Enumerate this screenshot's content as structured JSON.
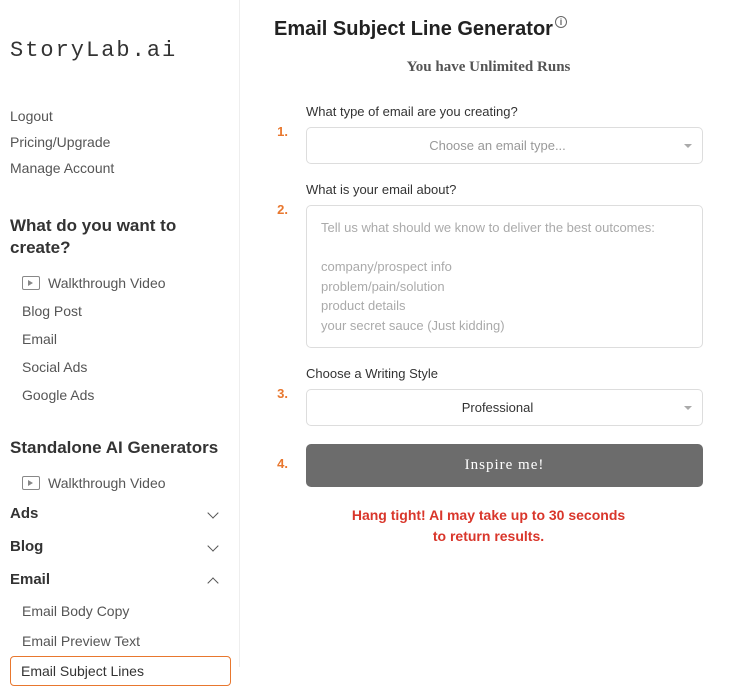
{
  "logo": "StoryLab.ai",
  "nav": {
    "logout": "Logout",
    "pricing": "Pricing/Upgrade",
    "manage": "Manage Account"
  },
  "create": {
    "title": "What do you want to create?",
    "walkthrough": "Walkthrough Video",
    "blog_post": "Blog Post",
    "email": "Email",
    "social_ads": "Social Ads",
    "google_ads": "Google Ads"
  },
  "standalone": {
    "title": "Standalone AI Generators",
    "walkthrough": "Walkthrough Video"
  },
  "accordions": {
    "ads": "Ads",
    "blog": "Blog",
    "email": "Email"
  },
  "email_sub": {
    "body": "Email Body Copy",
    "preview": "Email Preview Text",
    "subject": "Email Subject Lines"
  },
  "main": {
    "title": "Email Subject Line Generator",
    "runs": "You have Unlimited Runs",
    "step1": {
      "num": "1.",
      "label": "What type of email are you creating?",
      "placeholder": "Choose an email type..."
    },
    "step2": {
      "num": "2.",
      "label": "What is your email about?",
      "placeholder": "Tell us what should we know to deliver the best outcomes:\n\ncompany/prospect info\nproblem/pain/solution\nproduct details\nyour secret sauce (Just kidding)"
    },
    "step3": {
      "num": "3.",
      "label": "Choose a Writing Style",
      "value": "Professional"
    },
    "step4": {
      "num": "4.",
      "button": "Inspire me!"
    },
    "wait_line1": "Hang tight! AI may take up to 30 seconds",
    "wait_line2": "to return results."
  }
}
